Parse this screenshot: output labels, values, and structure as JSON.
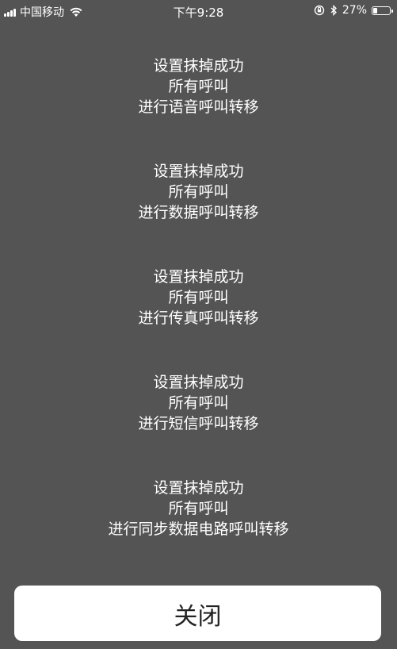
{
  "status_bar": {
    "carrier": "中国移动",
    "time": "下午9:28",
    "battery_percent": "27%",
    "battery_level": 0.27,
    "icons": [
      "signal-icon",
      "wifi-icon",
      "orientation-lock-icon",
      "bluetooth-icon",
      "battery-icon"
    ]
  },
  "messages": [
    {
      "line1": "设置抹掉成功",
      "line2": "所有呼叫",
      "line3": "进行语音呼叫转移"
    },
    {
      "line1": "设置抹掉成功",
      "line2": "所有呼叫",
      "line3": "进行数据呼叫转移"
    },
    {
      "line1": "设置抹掉成功",
      "line2": "所有呼叫",
      "line3": "进行传真呼叫转移"
    },
    {
      "line1": "设置抹掉成功",
      "line2": "所有呼叫",
      "line3": "进行短信呼叫转移"
    },
    {
      "line1": "设置抹掉成功",
      "line2": "所有呼叫",
      "line3": "进行同步数据电路呼叫转移"
    }
  ],
  "close_button": {
    "label": "关闭"
  },
  "colors": {
    "background": "#545454",
    "text": "#ffffff",
    "button_bg": "#ffffff",
    "button_text": "#222222"
  }
}
